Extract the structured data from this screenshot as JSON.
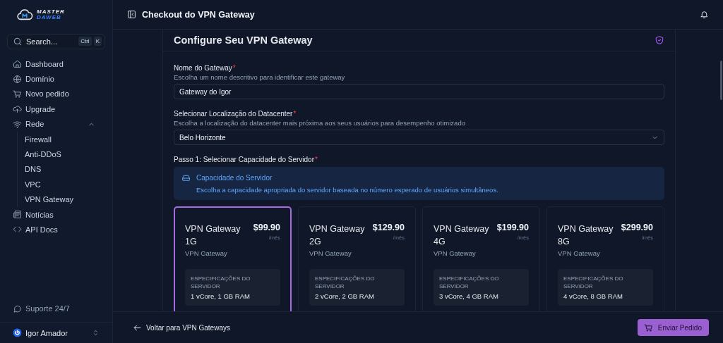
{
  "sidebar": {
    "logo": {
      "line_1": "MASTER",
      "line_2": "DAWEB"
    },
    "search": {
      "placeholder": "Search...",
      "keys": [
        "Ctrl",
        "K"
      ]
    },
    "nav": [
      {
        "label": "Dashboard"
      },
      {
        "label": "Domínio"
      },
      {
        "label": "Novo pedido"
      },
      {
        "label": "Upgrade"
      },
      {
        "label": "Rede",
        "expanded": true,
        "children": [
          {
            "label": "Firewall"
          },
          {
            "label": "Anti-DDoS"
          },
          {
            "label": "DNS"
          },
          {
            "label": "VPC"
          },
          {
            "label": "VPN Gateway"
          }
        ]
      },
      {
        "label": "Notícias"
      },
      {
        "label": "API Docs"
      }
    ],
    "support": "Suporte 24/7",
    "user": {
      "name": "Igor Amador"
    }
  },
  "header": {
    "title": "Checkout do VPN Gateway"
  },
  "form": {
    "title": "Configure Seu VPN Gateway",
    "fields": [
      {
        "kind": "text",
        "label": "Nome do Gateway",
        "required_mark": "*",
        "hint": "Escolha um nome descritivo para identificar este gateway",
        "value": "Gateway do Igor"
      },
      {
        "kind": "select",
        "label": "Selecionar Localização do Datacenter",
        "required_mark": "*",
        "hint": "Escolha a localização do datacenter mais próxima aos seus usuários para desempenho otimizado",
        "value": "Belo Horizonte"
      }
    ],
    "step": {
      "label": "Passo 1: Selecionar Capacidade do Servidor",
      "required_mark": "*"
    },
    "info": {
      "title": "Capacidade do Servidor",
      "text": "Escolha a capacidade apropriada do servidor baseada no número esperado de usuários simultâneos."
    },
    "plans": [
      {
        "name": "VPN Gateway 1G",
        "price": "$99.90",
        "period": "/mês",
        "type": "VPN Gateway",
        "specs_label": "ESPECIFICAÇÕES DO SERVIDOR",
        "specs": "1 vCore, 1 GB RAM",
        "selected": true
      },
      {
        "name": "VPN Gateway 2G",
        "price": "$129.90",
        "period": "/mês",
        "type": "VPN Gateway",
        "specs_label": "ESPECIFICAÇÕES DO SERVIDOR",
        "specs": "2 vCore, 2 GB RAM",
        "selected": false
      },
      {
        "name": "VPN Gateway 4G",
        "price": "$199.90",
        "period": "/mês",
        "type": "VPN Gateway",
        "specs_label": "ESPECIFICAÇÕES DO SERVIDOR",
        "specs": "3 vCore, 4 GB RAM",
        "selected": false
      },
      {
        "name": "VPN Gateway 8G",
        "price": "$299.90",
        "period": "/mês",
        "type": "VPN Gateway",
        "specs_label": "ESPECIFICAÇÕES DO SERVIDOR",
        "specs": "4 vCore, 8 GB RAM",
        "selected": false
      }
    ]
  },
  "footer": {
    "back": "Voltar para VPN Gateways",
    "submit": "Enviar Pedido"
  }
}
